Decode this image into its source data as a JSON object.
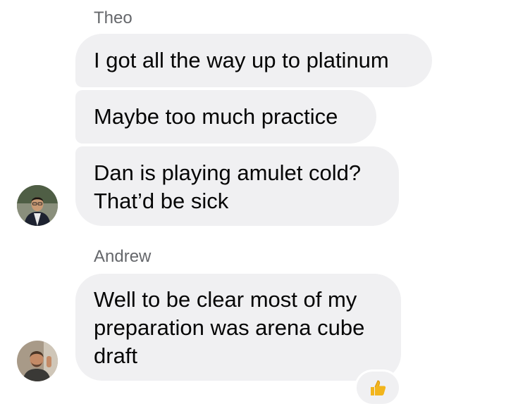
{
  "conversation": {
    "groups": [
      {
        "sender": "Theo",
        "messages": [
          {
            "lines": [
              "I got all the way up to platinum"
            ]
          },
          {
            "lines": [
              "Maybe too much practice"
            ]
          },
          {
            "lines": [
              "Dan is playing amulet cold?",
              "That’d be sick"
            ]
          }
        ],
        "avatar": "avatar-photo"
      },
      {
        "sender": "Andrew",
        "messages": [
          {
            "lines": [
              "Well to be clear most of my",
              "preparation was arena cube",
              "draft"
            ],
            "reaction": "thumbs-up-icon"
          }
        ],
        "avatar": "avatar-photo"
      }
    ]
  },
  "colors": {
    "bubble_background": "#f0f0f2",
    "sender_name": "#65676b",
    "message_text": "#050505",
    "reaction_thumb": "#f2b51c"
  }
}
